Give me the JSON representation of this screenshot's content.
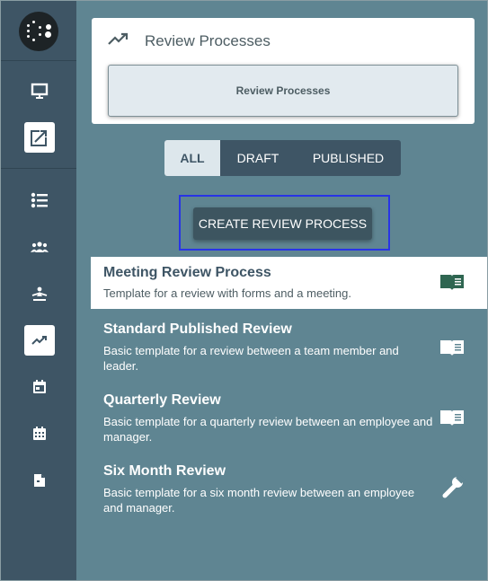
{
  "sidebar": {
    "logo_icon": "app-logo",
    "items": [
      {
        "icon": "presentation-icon",
        "active": false
      },
      {
        "icon": "trending-up-box-icon",
        "active": true
      },
      {
        "icon": "list-icon",
        "active": false
      },
      {
        "icon": "people-icon",
        "active": false
      },
      {
        "icon": "person-org-icon",
        "active": false
      },
      {
        "icon": "trend-line-icon",
        "active": true
      },
      {
        "icon": "calendar-day-icon",
        "active": false
      },
      {
        "icon": "calendar-grid-icon",
        "active": false
      },
      {
        "icon": "document-icon",
        "active": false
      }
    ]
  },
  "header": {
    "title": "Review Processes",
    "chip_label": "Review Processes"
  },
  "filters": {
    "all": "ALL",
    "draft": "DRAFT",
    "published": "PUBLISHED",
    "active": "ALL"
  },
  "create_button": "CREATE REVIEW PROCESS",
  "processes": [
    {
      "title": "Meeting Review Process",
      "description": "Template for a review with forms and a meeting.",
      "icon": "book-icon",
      "selected": true
    },
    {
      "title": "Standard Published Review",
      "description": "Basic template for a review between a team member and leader.",
      "icon": "book-icon",
      "selected": false
    },
    {
      "title": "Quarterly Review",
      "description": "Basic template for a quarterly review between an employee and manager.",
      "icon": "book-icon",
      "selected": false
    },
    {
      "title": "Six Month Review",
      "description": "Basic template for a six month review between an employee and manager.",
      "icon": "wrench-icon",
      "selected": false
    }
  ],
  "colors": {
    "sidebar": "#3e5565",
    "content_bg": "#5f8592",
    "accent_highlight": "#2834e6",
    "book_icon_selected": "#2f6651"
  }
}
